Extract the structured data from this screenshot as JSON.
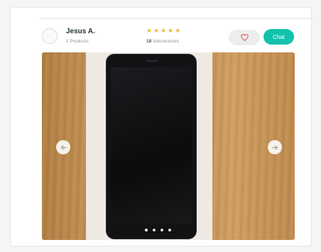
{
  "seller": {
    "name": "Jesus A.",
    "products": "1 Producto",
    "stars": "★★★★★",
    "ratings_count": "18",
    "ratings_label": "Valoraciones"
  },
  "actions": {
    "chat_label": "Chat",
    "favorite_icon": "heart-icon"
  },
  "gallery": {
    "prev_icon": "arrow-left-icon",
    "next_icon": "arrow-right-icon",
    "slide_count": 4,
    "active_slide": 1
  },
  "colors": {
    "brand": "#13c1ac",
    "star": "#f7b731",
    "heart": "#e25c5c"
  }
}
